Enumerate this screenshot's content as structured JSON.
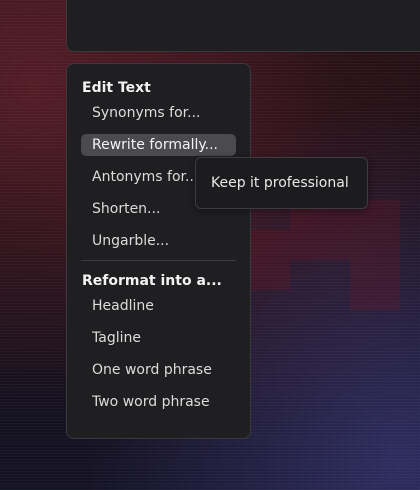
{
  "menu": {
    "sections": [
      {
        "header": "Edit Text",
        "items": [
          "Synonyms for...",
          "Rewrite formally...",
          "Antonyms for...",
          "Shorten...",
          "Ungarble..."
        ]
      },
      {
        "header": "Reformat into a...",
        "items": [
          "Headline",
          "Tagline",
          "One word phrase",
          "Two word phrase"
        ]
      }
    ],
    "highlighted_item": "Rewrite formally..."
  },
  "tooltip": {
    "text": "Keep it professional"
  },
  "colors": {
    "menu_background": "#1f1f21",
    "highlight": "#4a4a4f",
    "text": "#dcdcdc"
  }
}
